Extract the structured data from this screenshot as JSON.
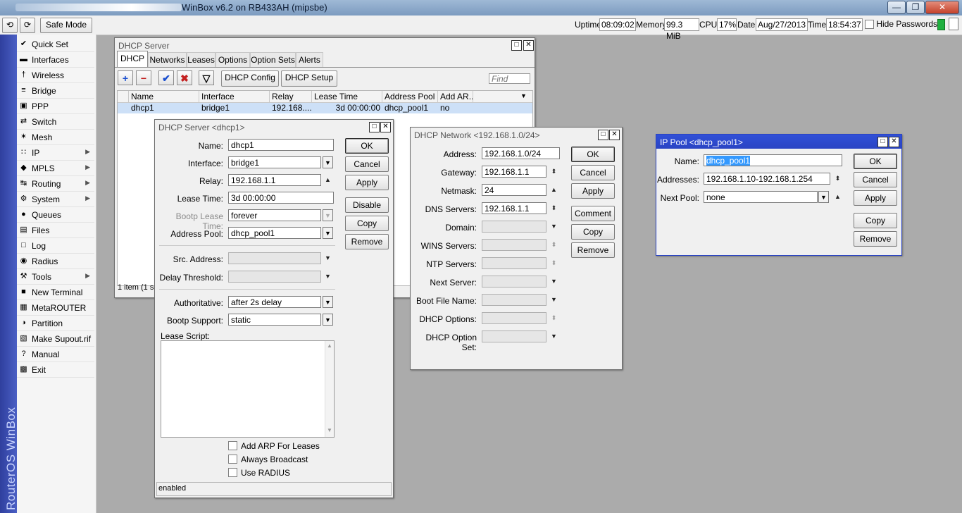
{
  "app": {
    "title": "WinBox v6.2 on RB433AH (mipsbe)"
  },
  "toolbar": {
    "undo_glyph": "⟲",
    "redo_glyph": "⟳",
    "safe_mode": "Safe Mode",
    "uptime_label": "Uptime:",
    "uptime": "08:09:02",
    "memory_label": "Memory:",
    "memory": "99.3 MiB",
    "cpu_label": "CPU:",
    "cpu": "17%",
    "date_label": "Date:",
    "date": "Aug/27/2013",
    "time_label": "Time:",
    "time": "18:54:37",
    "hide_passwords": "Hide Passwords"
  },
  "sidebar": {
    "brand": "RouterOS WinBox",
    "items": [
      {
        "label": "Quick Set",
        "icon": "quick-set-icon",
        "glyph": "✔",
        "submenu": false
      },
      {
        "label": "Interfaces",
        "icon": "interfaces-icon",
        "glyph": "▬",
        "submenu": false
      },
      {
        "label": "Wireless",
        "icon": "wireless-icon",
        "glyph": "†",
        "submenu": false
      },
      {
        "label": "Bridge",
        "icon": "bridge-icon",
        "glyph": "≡",
        "submenu": false
      },
      {
        "label": "PPP",
        "icon": "ppp-icon",
        "glyph": "▣",
        "submenu": false
      },
      {
        "label": "Switch",
        "icon": "switch-icon",
        "glyph": "⇄",
        "submenu": false
      },
      {
        "label": "Mesh",
        "icon": "mesh-icon",
        "glyph": "✶",
        "submenu": false
      },
      {
        "label": "IP",
        "icon": "ip-icon",
        "glyph": "∷",
        "submenu": true
      },
      {
        "label": "MPLS",
        "icon": "mpls-icon",
        "glyph": "◆",
        "submenu": true
      },
      {
        "label": "Routing",
        "icon": "routing-icon",
        "glyph": "↹",
        "submenu": true
      },
      {
        "label": "System",
        "icon": "system-icon",
        "glyph": "⚙",
        "submenu": true
      },
      {
        "label": "Queues",
        "icon": "queues-icon",
        "glyph": "●",
        "submenu": false
      },
      {
        "label": "Files",
        "icon": "files-icon",
        "glyph": "▤",
        "submenu": false
      },
      {
        "label": "Log",
        "icon": "log-icon",
        "glyph": "□",
        "submenu": false
      },
      {
        "label": "Radius",
        "icon": "radius-icon",
        "glyph": "◉",
        "submenu": false
      },
      {
        "label": "Tools",
        "icon": "tools-icon",
        "glyph": "⚒",
        "submenu": true
      },
      {
        "label": "New Terminal",
        "icon": "terminal-icon",
        "glyph": "■",
        "submenu": false
      },
      {
        "label": "MetaROUTER",
        "icon": "metarouter-icon",
        "glyph": "▦",
        "submenu": false
      },
      {
        "label": "Partition",
        "icon": "partition-icon",
        "glyph": "◑",
        "submenu": false
      },
      {
        "label": "Make Supout.rif",
        "icon": "supout-icon",
        "glyph": "▧",
        "submenu": false
      },
      {
        "label": "Manual",
        "icon": "manual-icon",
        "glyph": "?",
        "submenu": false
      },
      {
        "label": "Exit",
        "icon": "exit-icon",
        "glyph": "▩",
        "submenu": false
      }
    ]
  },
  "dhcp_server_list": {
    "title": "DHCP Server",
    "tabs": [
      "DHCP",
      "Networks",
      "Leases",
      "Options",
      "Option Sets",
      "Alerts"
    ],
    "add_glyph": "+",
    "remove_glyph": "−",
    "enable_glyph": "✔",
    "disable_glyph": "✖",
    "filter_glyph": "▽",
    "dhcp_config": "DHCP Config",
    "dhcp_setup": "DHCP Setup",
    "find_placeholder": "Find",
    "columns": [
      "Name",
      "Interface",
      "Relay",
      "Lease Time",
      "Address Pool",
      "Add AR..."
    ],
    "rows": [
      {
        "name": "dhcp1",
        "interface": "bridge1",
        "relay": "192.168....",
        "lease_time": "3d 00:00:00",
        "address_pool": "dhcp_pool1",
        "add_arp": "no"
      }
    ],
    "status": "1 item (1 se"
  },
  "dhcp_server_edit": {
    "title": "DHCP Server <dhcp1>",
    "name_label": "Name:",
    "name": "dhcp1",
    "interface_label": "Interface:",
    "interface": "bridge1",
    "relay_label": "Relay:",
    "relay": "192.168.1.1",
    "lease_time_label": "Lease Time:",
    "lease_time": "3d 00:00:00",
    "bootp_lease_time_label": "Bootp Lease Time:",
    "bootp_lease_time": "forever",
    "address_pool_label": "Address Pool:",
    "address_pool": "dhcp_pool1",
    "src_address_label": "Src. Address:",
    "delay_threshold_label": "Delay Threshold:",
    "authoritative_label": "Authoritative:",
    "authoritative": "after 2s delay",
    "bootp_support_label": "Bootp Support:",
    "bootp_support": "static",
    "lease_script_label": "Lease Script:",
    "add_arp": "Add ARP For Leases",
    "always_broadcast": "Always Broadcast",
    "use_radius": "Use RADIUS",
    "status": "enabled",
    "buttons": {
      "ok": "OK",
      "cancel": "Cancel",
      "apply": "Apply",
      "disable": "Disable",
      "copy": "Copy",
      "remove": "Remove"
    }
  },
  "dhcp_network_edit": {
    "title": "DHCP Network <192.168.1.0/24>",
    "address_label": "Address:",
    "address": "192.168.1.0/24",
    "gateway_label": "Gateway:",
    "gateway": "192.168.1.1",
    "netmask_label": "Netmask:",
    "netmask": "24",
    "dns_label": "DNS Servers:",
    "dns": "192.168.1.1",
    "domain_label": "Domain:",
    "wins_label": "WINS Servers:",
    "ntp_label": "NTP Servers:",
    "next_server_label": "Next Server:",
    "boot_file_label": "Boot File Name:",
    "dhcp_options_label": "DHCP Options:",
    "dhcp_option_set_label": "DHCP Option Set:",
    "buttons": {
      "ok": "OK",
      "cancel": "Cancel",
      "apply": "Apply",
      "comment": "Comment",
      "copy": "Copy",
      "remove": "Remove"
    }
  },
  "ip_pool_edit": {
    "title": "IP Pool <dhcp_pool1>",
    "name_label": "Name:",
    "name": "dhcp_pool1",
    "addresses_label": "Addresses:",
    "addresses": "192.168.1.10-192.168.1.254",
    "next_pool_label": "Next Pool:",
    "next_pool": "none",
    "buttons": {
      "ok": "OK",
      "cancel": "Cancel",
      "apply": "Apply",
      "copy": "Copy",
      "remove": "Remove"
    }
  },
  "glyphs": {
    "up": "▲",
    "down": "▼",
    "updown": "⬍",
    "dropdown": "▼",
    "maximize": "□",
    "close": "✕",
    "minimize": "—",
    "restore": "❐",
    "submenu": "▶"
  },
  "colors": {
    "active_title": "#2a44c4",
    "sidebar_strip": "#3a4db0",
    "selected_row": "#cde0f7",
    "selected_text": "#3399ff"
  }
}
